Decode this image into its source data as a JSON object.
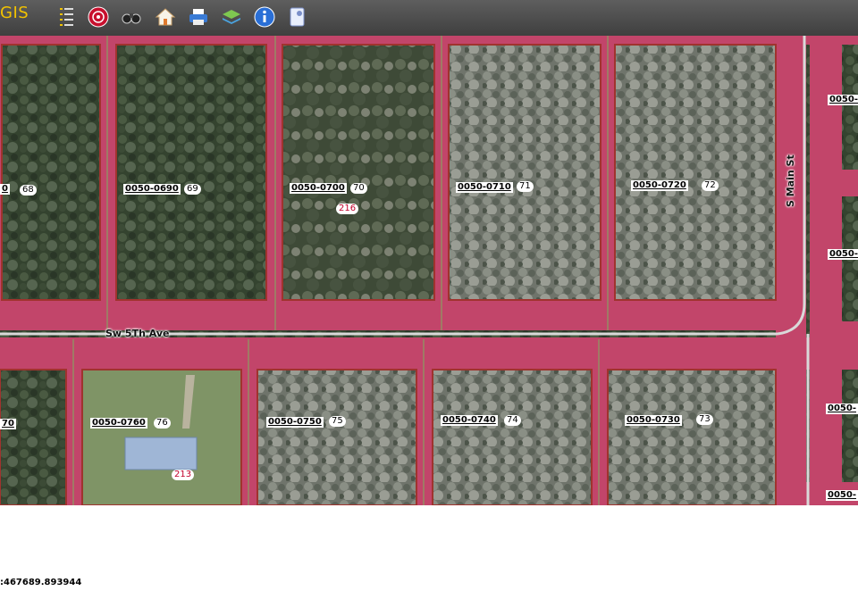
{
  "app": {
    "logo_text": "GIS"
  },
  "toolbar": {
    "buttons": [
      {
        "name": "layers-list-button",
        "icon": "layers-list-icon"
      },
      {
        "name": "target-button",
        "icon": "target-icon"
      },
      {
        "name": "binoculars-button",
        "icon": "binoculars-icon"
      },
      {
        "name": "home-button",
        "icon": "home-icon"
      },
      {
        "name": "print-button",
        "icon": "printer-icon"
      },
      {
        "name": "layers-button",
        "icon": "layers-stack-icon"
      },
      {
        "name": "info-button",
        "icon": "info-icon"
      },
      {
        "name": "document-button",
        "icon": "document-icon"
      }
    ]
  },
  "map": {
    "streets": {
      "horizontal": "Sw 5Th Ave",
      "vertical": "S Main St"
    },
    "parcels": [
      {
        "id": "0",
        "lot": "68"
      },
      {
        "id": "0050-0690",
        "lot": "69"
      },
      {
        "id": "0050-0700",
        "lot": "70",
        "address": "216"
      },
      {
        "id": "0050-0710",
        "lot": "71"
      },
      {
        "id": "0050-0720",
        "lot": "72"
      },
      {
        "id": "0050-",
        "lot": ""
      },
      {
        "id": "0050-",
        "lot": ""
      },
      {
        "id": "70",
        "lot": ""
      },
      {
        "id": "0050-0760",
        "lot": "76",
        "address": "213"
      },
      {
        "id": "0050-0750",
        "lot": "75"
      },
      {
        "id": "0050-0740",
        "lot": "74"
      },
      {
        "id": "0050-0730",
        "lot": "73"
      },
      {
        "id": "0050-",
        "lot": ""
      },
      {
        "id": "0050-",
        "lot": ""
      }
    ],
    "colors": {
      "right_of_way": "#c2456a",
      "parcel_line": "#a0332e",
      "aerial_dark": "#34432f",
      "aerial_light": "#8a8f85",
      "logo": "#f2c200"
    }
  },
  "status": {
    "coordinate_text": ":467689.893944"
  }
}
